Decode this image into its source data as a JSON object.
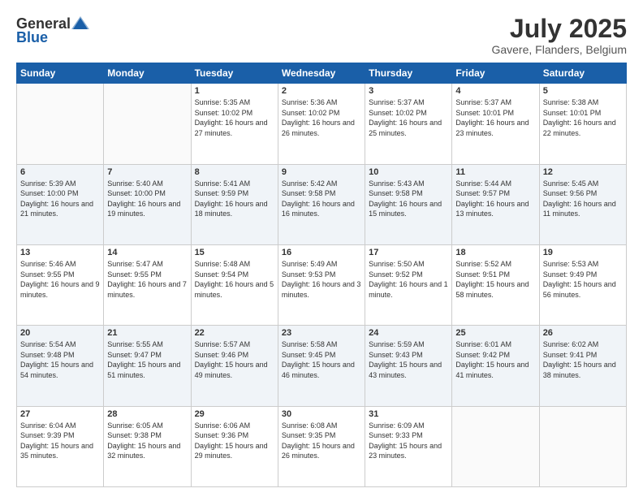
{
  "header": {
    "logo": {
      "text_general": "General",
      "text_blue": "Blue"
    },
    "title": "July 2025",
    "location": "Gavere, Flanders, Belgium"
  },
  "calendar": {
    "days_of_week": [
      "Sunday",
      "Monday",
      "Tuesday",
      "Wednesday",
      "Thursday",
      "Friday",
      "Saturday"
    ],
    "weeks": [
      [
        {
          "day": "",
          "info": ""
        },
        {
          "day": "",
          "info": ""
        },
        {
          "day": "1",
          "info": "Sunrise: 5:35 AM\nSunset: 10:02 PM\nDaylight: 16 hours\nand 27 minutes."
        },
        {
          "day": "2",
          "info": "Sunrise: 5:36 AM\nSunset: 10:02 PM\nDaylight: 16 hours\nand 26 minutes."
        },
        {
          "day": "3",
          "info": "Sunrise: 5:37 AM\nSunset: 10:02 PM\nDaylight: 16 hours\nand 25 minutes."
        },
        {
          "day": "4",
          "info": "Sunrise: 5:37 AM\nSunset: 10:01 PM\nDaylight: 16 hours\nand 23 minutes."
        },
        {
          "day": "5",
          "info": "Sunrise: 5:38 AM\nSunset: 10:01 PM\nDaylight: 16 hours\nand 22 minutes."
        }
      ],
      [
        {
          "day": "6",
          "info": "Sunrise: 5:39 AM\nSunset: 10:00 PM\nDaylight: 16 hours\nand 21 minutes."
        },
        {
          "day": "7",
          "info": "Sunrise: 5:40 AM\nSunset: 10:00 PM\nDaylight: 16 hours\nand 19 minutes."
        },
        {
          "day": "8",
          "info": "Sunrise: 5:41 AM\nSunset: 9:59 PM\nDaylight: 16 hours\nand 18 minutes."
        },
        {
          "day": "9",
          "info": "Sunrise: 5:42 AM\nSunset: 9:58 PM\nDaylight: 16 hours\nand 16 minutes."
        },
        {
          "day": "10",
          "info": "Sunrise: 5:43 AM\nSunset: 9:58 PM\nDaylight: 16 hours\nand 15 minutes."
        },
        {
          "day": "11",
          "info": "Sunrise: 5:44 AM\nSunset: 9:57 PM\nDaylight: 16 hours\nand 13 minutes."
        },
        {
          "day": "12",
          "info": "Sunrise: 5:45 AM\nSunset: 9:56 PM\nDaylight: 16 hours\nand 11 minutes."
        }
      ],
      [
        {
          "day": "13",
          "info": "Sunrise: 5:46 AM\nSunset: 9:55 PM\nDaylight: 16 hours\nand 9 minutes."
        },
        {
          "day": "14",
          "info": "Sunrise: 5:47 AM\nSunset: 9:55 PM\nDaylight: 16 hours\nand 7 minutes."
        },
        {
          "day": "15",
          "info": "Sunrise: 5:48 AM\nSunset: 9:54 PM\nDaylight: 16 hours\nand 5 minutes."
        },
        {
          "day": "16",
          "info": "Sunrise: 5:49 AM\nSunset: 9:53 PM\nDaylight: 16 hours\nand 3 minutes."
        },
        {
          "day": "17",
          "info": "Sunrise: 5:50 AM\nSunset: 9:52 PM\nDaylight: 16 hours\nand 1 minute."
        },
        {
          "day": "18",
          "info": "Sunrise: 5:52 AM\nSunset: 9:51 PM\nDaylight: 15 hours\nand 58 minutes."
        },
        {
          "day": "19",
          "info": "Sunrise: 5:53 AM\nSunset: 9:49 PM\nDaylight: 15 hours\nand 56 minutes."
        }
      ],
      [
        {
          "day": "20",
          "info": "Sunrise: 5:54 AM\nSunset: 9:48 PM\nDaylight: 15 hours\nand 54 minutes."
        },
        {
          "day": "21",
          "info": "Sunrise: 5:55 AM\nSunset: 9:47 PM\nDaylight: 15 hours\nand 51 minutes."
        },
        {
          "day": "22",
          "info": "Sunrise: 5:57 AM\nSunset: 9:46 PM\nDaylight: 15 hours\nand 49 minutes."
        },
        {
          "day": "23",
          "info": "Sunrise: 5:58 AM\nSunset: 9:45 PM\nDaylight: 15 hours\nand 46 minutes."
        },
        {
          "day": "24",
          "info": "Sunrise: 5:59 AM\nSunset: 9:43 PM\nDaylight: 15 hours\nand 43 minutes."
        },
        {
          "day": "25",
          "info": "Sunrise: 6:01 AM\nSunset: 9:42 PM\nDaylight: 15 hours\nand 41 minutes."
        },
        {
          "day": "26",
          "info": "Sunrise: 6:02 AM\nSunset: 9:41 PM\nDaylight: 15 hours\nand 38 minutes."
        }
      ],
      [
        {
          "day": "27",
          "info": "Sunrise: 6:04 AM\nSunset: 9:39 PM\nDaylight: 15 hours\nand 35 minutes."
        },
        {
          "day": "28",
          "info": "Sunrise: 6:05 AM\nSunset: 9:38 PM\nDaylight: 15 hours\nand 32 minutes."
        },
        {
          "day": "29",
          "info": "Sunrise: 6:06 AM\nSunset: 9:36 PM\nDaylight: 15 hours\nand 29 minutes."
        },
        {
          "day": "30",
          "info": "Sunrise: 6:08 AM\nSunset: 9:35 PM\nDaylight: 15 hours\nand 26 minutes."
        },
        {
          "day": "31",
          "info": "Sunrise: 6:09 AM\nSunset: 9:33 PM\nDaylight: 15 hours\nand 23 minutes."
        },
        {
          "day": "",
          "info": ""
        },
        {
          "day": "",
          "info": ""
        }
      ]
    ]
  }
}
